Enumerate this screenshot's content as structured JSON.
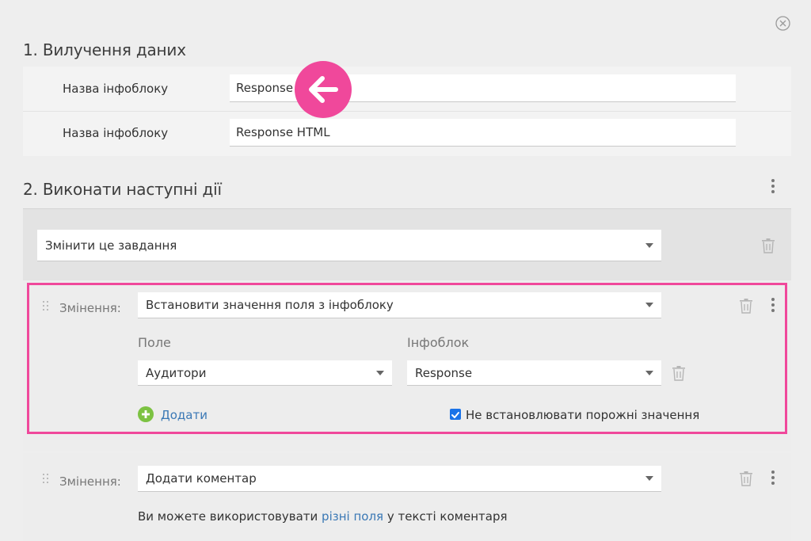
{
  "section1": {
    "title": "1. Вилучення даних",
    "rows": [
      {
        "label": "Назва інфоблоку",
        "value": "Response"
      },
      {
        "label": "Назва інфоблоку",
        "value": "Response HTML"
      }
    ]
  },
  "section2": {
    "title": "2. Виконати наступні дії",
    "action_select": "Змінити це завдання",
    "change1": {
      "label": "Змінення:",
      "select": "Встановити значення поля з інфоблоку",
      "field_header": "Поле",
      "infoblock_header": "Інфоблок",
      "field_value": "Аудитори",
      "infoblock_value": "Response",
      "add_label": "Додати",
      "checkbox_label": "Не встановлювати порожні значення",
      "checkbox_checked": true
    },
    "change2": {
      "label": "Змінення:",
      "select": "Додати коментар",
      "hint_prefix": "Ви можете використовувати ",
      "hint_link": "різні поля",
      "hint_suffix": " у тексті коментаря"
    }
  },
  "colors": {
    "highlight": "#f0489b",
    "link": "#3a78b5",
    "add_icon": "#7cc242",
    "checkbox": "#1a73e8"
  },
  "icons": {
    "close": "close-circle-icon",
    "arrow": "arrow-left-icon",
    "trash": "trash-icon",
    "kebab": "more-vertical-icon",
    "grip": "drag-handle-icon",
    "add": "plus-circle-icon",
    "caret": "caret-down-icon"
  }
}
